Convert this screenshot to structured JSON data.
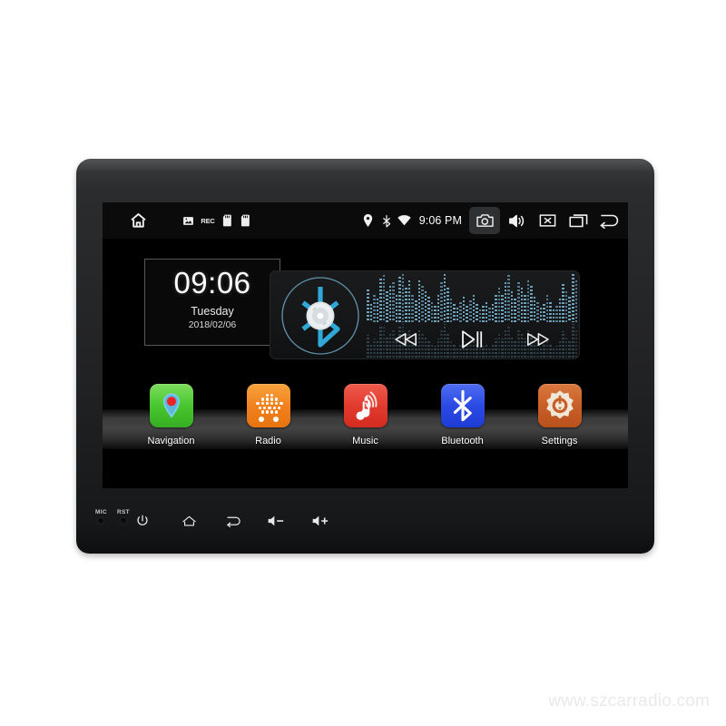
{
  "product": {
    "watermark": "www.szcarradio.com"
  },
  "statusbar": {
    "left_icons": [
      {
        "name": "home-icon",
        "label": "home"
      },
      {
        "name": "photo-icon",
        "label": "photo"
      },
      {
        "name": "rec-icon",
        "label": "REC"
      },
      {
        "name": "sdcard-icon-1",
        "label": "sd card 1"
      },
      {
        "name": "sdcard-icon-2",
        "label": "sd card 2"
      }
    ],
    "right_icons": [
      {
        "name": "location-icon",
        "label": "gps"
      },
      {
        "name": "bluetooth-status-icon",
        "label": "bluetooth"
      },
      {
        "name": "wifi-icon",
        "label": "wifi"
      }
    ],
    "time": "9:06 PM",
    "buttons": [
      {
        "name": "camera-button",
        "label": "camera",
        "selected": true
      },
      {
        "name": "volume-button",
        "label": "volume"
      },
      {
        "name": "mute-button",
        "label": "mute"
      },
      {
        "name": "recents-button",
        "label": "recents"
      },
      {
        "name": "back-button",
        "label": "back"
      }
    ]
  },
  "clock_widget": {
    "time": "09:06",
    "weekday": "Tuesday",
    "date": "2018/02/06"
  },
  "media_widget": {
    "source_icon": "bluetooth-disc-icon",
    "controls": [
      {
        "name": "previous-button",
        "label": "previous"
      },
      {
        "name": "play-pause-button",
        "label": "play pause"
      },
      {
        "name": "next-button",
        "label": "next"
      }
    ],
    "equalizer": {
      "bar_color": "#6ea3bd",
      "levels": [
        36,
        20,
        30,
        26,
        48,
        52,
        34,
        40,
        44,
        30,
        50,
        56,
        38,
        46,
        30,
        24,
        46,
        40,
        34,
        28,
        22,
        18,
        30,
        44,
        56,
        38,
        26,
        20,
        16,
        22,
        28,
        18,
        24,
        30,
        20,
        14,
        18,
        22,
        16,
        20,
        30,
        38,
        30,
        44,
        52,
        34,
        26,
        44,
        38,
        30,
        46,
        40,
        28,
        22,
        16,
        20,
        30,
        22,
        14,
        18,
        26,
        42,
        34,
        28,
        56,
        46
      ]
    }
  },
  "apps": [
    {
      "name": "app-navigation",
      "label": "Navigation",
      "icon": "map-pin-icon",
      "color": "#49c62f"
    },
    {
      "name": "app-radio",
      "label": "Radio",
      "icon": "radio-speaker-icon",
      "color": "#f1821e"
    },
    {
      "name": "app-music",
      "label": "Music",
      "icon": "music-note-icon",
      "color": "#e23b2e"
    },
    {
      "name": "app-bluetooth",
      "label": "Bluetooth",
      "icon": "bluetooth-icon",
      "color": "#2b4ae4"
    },
    {
      "name": "app-settings",
      "label": "Settings",
      "icon": "gear-icon",
      "color": "#c95f28"
    }
  ],
  "bezel": {
    "mic_label": "MIC",
    "rst_label": "RST",
    "buttons": [
      {
        "name": "power-button",
        "label": "power"
      },
      {
        "name": "home-hard-button",
        "label": "home"
      },
      {
        "name": "back-hard-button",
        "label": "back"
      },
      {
        "name": "volume-down-button",
        "label": "volume down"
      },
      {
        "name": "volume-up-button",
        "label": "volume up"
      }
    ]
  }
}
